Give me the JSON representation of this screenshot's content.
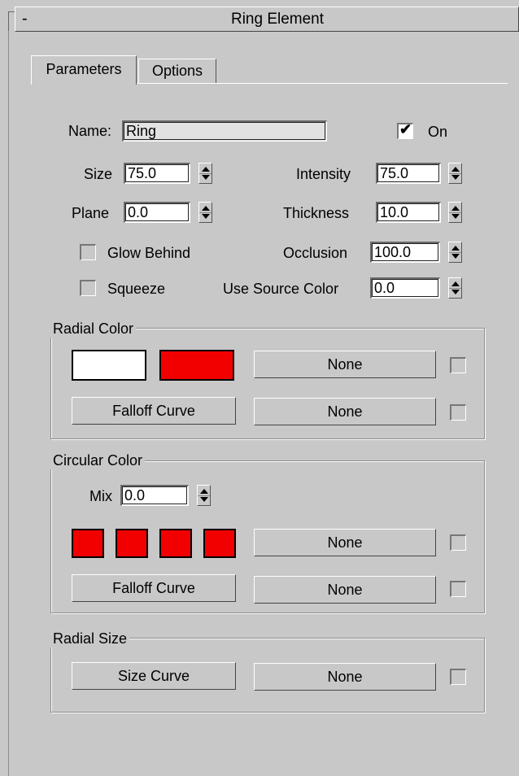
{
  "rollout": {
    "collapse_symbol": "-",
    "title": "Ring Element"
  },
  "tabs": [
    {
      "label": "Parameters",
      "active": true
    },
    {
      "label": "Options",
      "active": false
    }
  ],
  "params": {
    "name_label": "Name:",
    "name_value": "Ring",
    "on_label": "On",
    "on_checked": true,
    "size_label": "Size",
    "size_value": "75.0",
    "intensity_label": "Intensity",
    "intensity_value": "75.0",
    "plane_label": "Plane",
    "plane_value": "0.0",
    "thickness_label": "Thickness",
    "thickness_value": "10.0",
    "glow_behind_label": "Glow Behind",
    "glow_behind_checked": false,
    "occlusion_label": "Occlusion",
    "occlusion_value": "100.0",
    "squeeze_label": "Squeeze",
    "squeeze_checked": false,
    "use_source_color_label": "Use Source Color",
    "use_source_color_value": "0.0"
  },
  "radial_color": {
    "title": "Radial Color",
    "swatch_colors": [
      "#ffffff",
      "#f20000"
    ],
    "map_label": "None",
    "falloff_label": "Falloff Curve",
    "falloff_map_label": "None"
  },
  "circular_color": {
    "title": "Circular Color",
    "mix_label": "Mix",
    "mix_value": "0.0",
    "swatch_colors": [
      "#f20000",
      "#f20000",
      "#f20000",
      "#f20000"
    ],
    "map_label": "None",
    "falloff_label": "Falloff Curve",
    "falloff_map_label": "None"
  },
  "radial_size": {
    "title": "Radial Size",
    "size_curve_label": "Size Curve",
    "map_label": "None"
  }
}
